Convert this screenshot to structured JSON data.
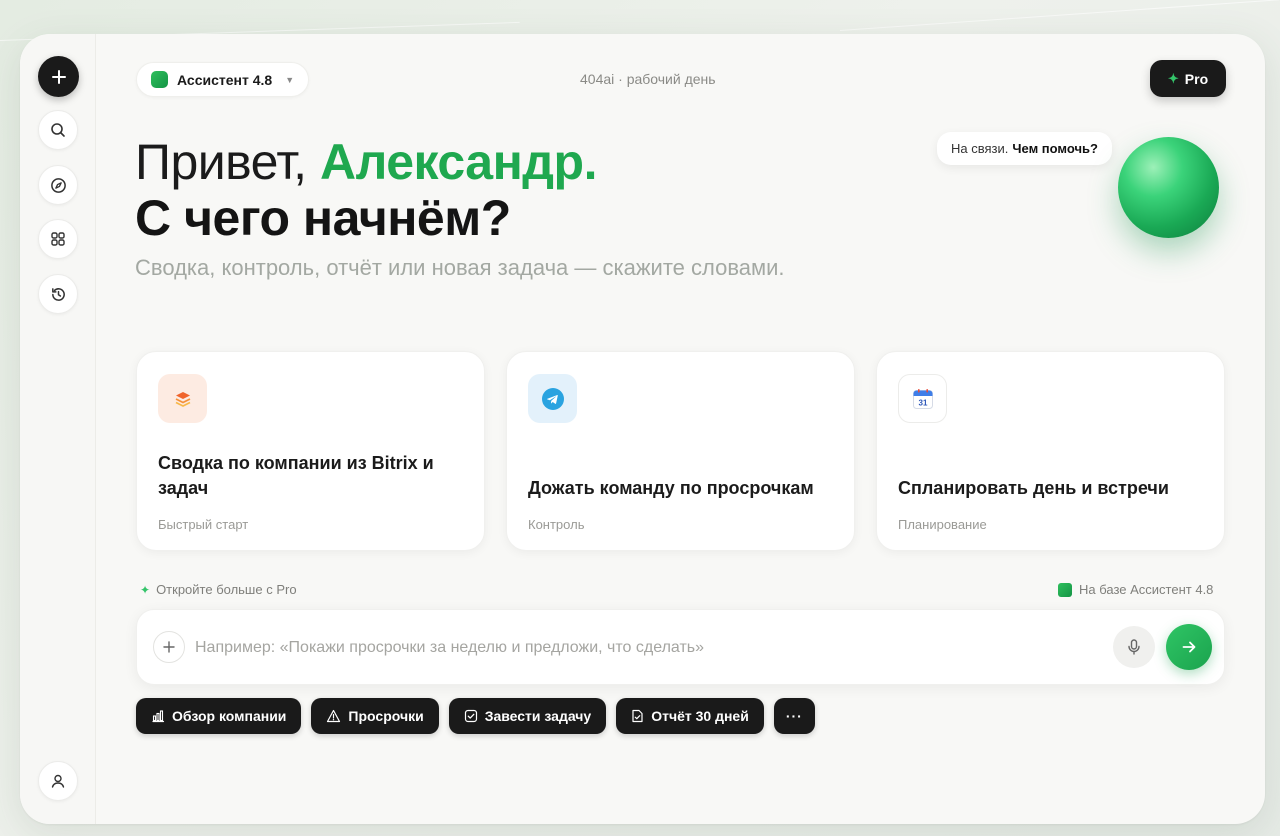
{
  "header": {
    "model_label": "Ассистент 4.8",
    "center_text": "404ai · рабочий день",
    "pro_label": "Pro"
  },
  "greeting": {
    "hello": "Привет,",
    "name": "Александр.",
    "question": "С чего начнём?",
    "subtitle": "Сводка, контроль, отчёт или новая задача — скажите словами."
  },
  "assistant": {
    "bubble_plain": "На связи.",
    "bubble_bold": "Чем помочь?"
  },
  "cards": [
    {
      "title": "Сводка по компании из Bitrix и задач",
      "tag": "Быстрый старт",
      "icon": "layers-icon"
    },
    {
      "title": "Дожать команду по просрочкам",
      "tag": "Контроль",
      "icon": "telegram-icon"
    },
    {
      "title": "Спланировать день и встречи",
      "tag": "Планирование",
      "icon": "calendar-icon",
      "calendar_day": "31"
    }
  ],
  "hints": {
    "left": "Откройте больше с Pro",
    "right": "На базе Ассистент 4.8"
  },
  "composer": {
    "placeholder": "Например: «Покажи просрочки за неделю и предложи, что сделать»"
  },
  "chips": [
    {
      "label": "Обзор компании",
      "icon": "bar-chart-icon"
    },
    {
      "label": "Просрочки",
      "icon": "warning-icon"
    },
    {
      "label": "Завести задачу",
      "icon": "checkbox-icon"
    },
    {
      "label": "Отчёт 30 дней",
      "icon": "document-icon"
    },
    {
      "label": "···",
      "icon": "more-icon"
    }
  ],
  "colors": {
    "accent_green": "#1fa84f",
    "dark": "#1a1a1a",
    "muted": "#a3a8a2"
  }
}
